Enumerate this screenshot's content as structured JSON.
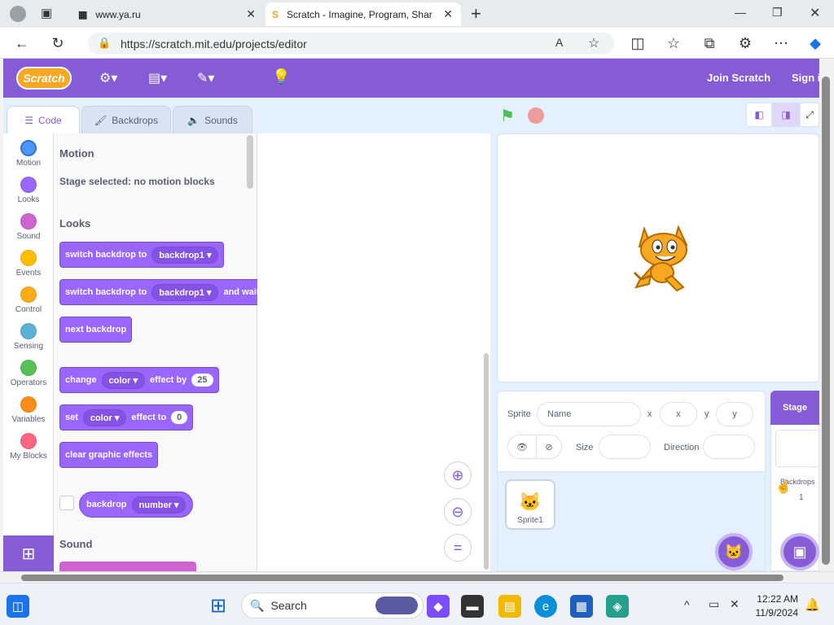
{
  "browser": {
    "tabs": [
      {
        "title": "www.ya.ru",
        "active": false
      },
      {
        "title": "Scratch - Imagine, Program, Shar",
        "active": true
      }
    ],
    "url": "https://scratch.mit.edu/projects/editor",
    "new_tab": "+"
  },
  "menubar": {
    "logo": "Scratch",
    "join": "Join Scratch",
    "signin": "Sign i"
  },
  "editor_tabs": {
    "code": "Code",
    "backdrops": "Backdrops",
    "sounds": "Sounds"
  },
  "categories": [
    {
      "label": "Motion",
      "color": "#4c97ff"
    },
    {
      "label": "Looks",
      "color": "#9966ff"
    },
    {
      "label": "Sound",
      "color": "#cf63cf"
    },
    {
      "label": "Events",
      "color": "#ffbf00"
    },
    {
      "label": "Control",
      "color": "#ffab19"
    },
    {
      "label": "Sensing",
      "color": "#5cb1d6"
    },
    {
      "label": "Operators",
      "color": "#59c059"
    },
    {
      "label": "Variables",
      "color": "#ff8c1a"
    },
    {
      "label": "My Blocks",
      "color": "#ff6680"
    }
  ],
  "palette": {
    "motion_heading": "Motion",
    "motion_note": "Stage selected: no motion blocks",
    "looks_heading": "Looks",
    "sound_heading": "Sound",
    "blocks": {
      "b1": {
        "text": "switch backdrop to",
        "menu": "backdrop1"
      },
      "b2": {
        "text": "switch backdrop to",
        "menu": "backdrop1",
        "suffix": "and wait"
      },
      "b3": {
        "text": "next backdrop"
      },
      "b4": {
        "text": "change",
        "menu": "color",
        "mid": "effect by",
        "value": "25"
      },
      "b5": {
        "text": "set",
        "menu": "color",
        "mid": "effect to",
        "value": "0"
      },
      "b6": {
        "text": "clear graphic effects"
      },
      "b7": {
        "text": "backdrop",
        "menu": "number"
      }
    }
  },
  "sprite_info": {
    "sprite_label": "Sprite",
    "name_placeholder": "Name",
    "x_label": "x",
    "x_placeholder": "x",
    "y_label": "y",
    "y_placeholder": "y",
    "size_label": "Size",
    "direction_label": "Direction"
  },
  "sprites": [
    {
      "name": "Sprite1"
    }
  ],
  "stage_panel": {
    "title": "Stage",
    "backdrops_label": "Backdrops",
    "backdrops_count": "1"
  },
  "taskbar": {
    "search": "Search",
    "time": "12:22 AM",
    "date": "11/9/2024"
  },
  "colors": {
    "scratch_purple": "#855cd6",
    "looks": "#9966ff",
    "editor_bg": "#e5f0ff"
  }
}
